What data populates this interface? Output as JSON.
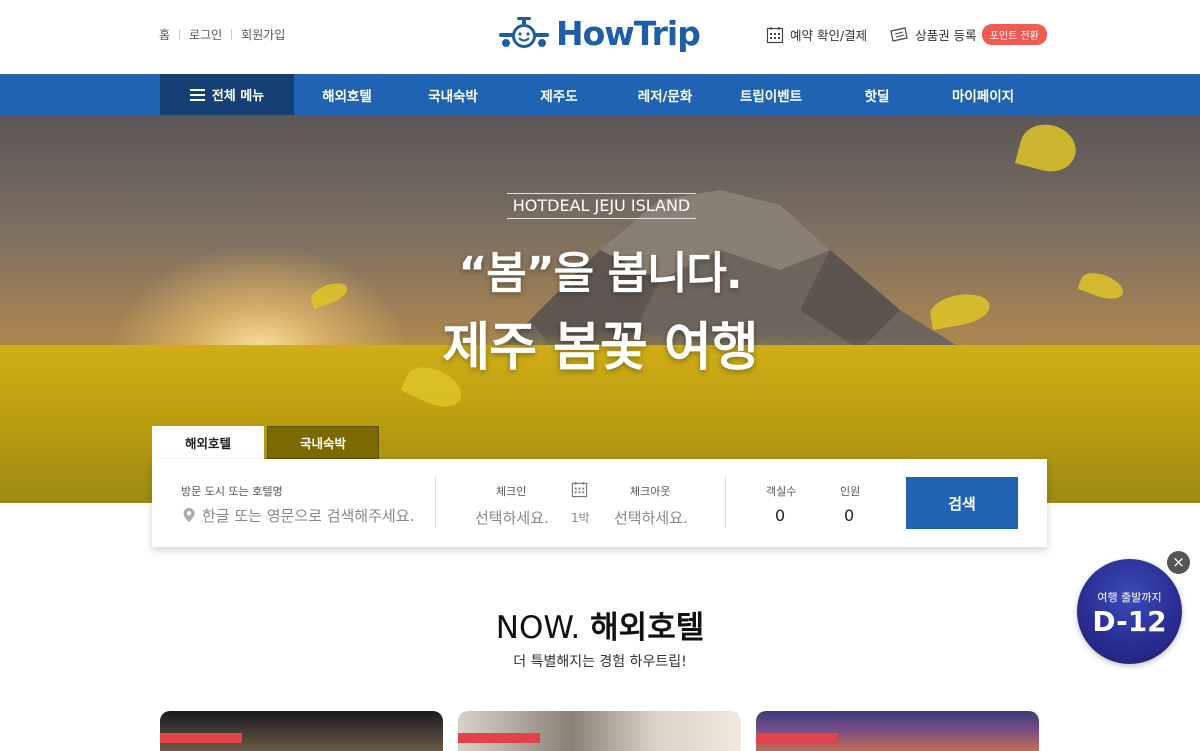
{
  "header": {
    "util_links": [
      "홈",
      "로그인",
      "회원가입"
    ],
    "logo_text": "HowTrip",
    "reservation_label": "예약 확인/결제",
    "voucher_label": "상품권 등록",
    "point_badge": "포인트 전환"
  },
  "nav": {
    "all_menu": "전체 메뉴",
    "items": [
      "해외호텔",
      "국내숙박",
      "제주도",
      "레저/문화",
      "트립이벤트",
      "핫딜",
      "마이페이지"
    ]
  },
  "hero": {
    "tag": "HOTDEAL JEJU ISLAND",
    "title1": "“봄”을 봅니다.",
    "title2": "제주 봄꽃 여행"
  },
  "search": {
    "tabs": [
      "해외호텔",
      "국내숙박"
    ],
    "destination_label": "방문 도시 또는 호텔명",
    "destination_placeholder": "한글 또는 영문으로 검색해주세요.",
    "checkin_label": "체크인",
    "checkin_value": "선택하세요.",
    "nights": "1박",
    "checkout_label": "체크아웃",
    "checkout_value": "선택하세요.",
    "rooms_label": "객실수",
    "rooms_value": "0",
    "guests_label": "인원",
    "guests_value": "0",
    "search_button": "검색"
  },
  "section": {
    "title_prefix": "NOW.",
    "title_main": "해외호텔",
    "subtitle": "더 특별해지는 경험 하우트립!"
  },
  "dday": {
    "label": "여행 출발까지",
    "value": "D-12",
    "close": "×"
  },
  "colors": {
    "brand_blue": "#2063b3",
    "nav_dark": "#163f74",
    "badge_red": "#ef5a52"
  }
}
